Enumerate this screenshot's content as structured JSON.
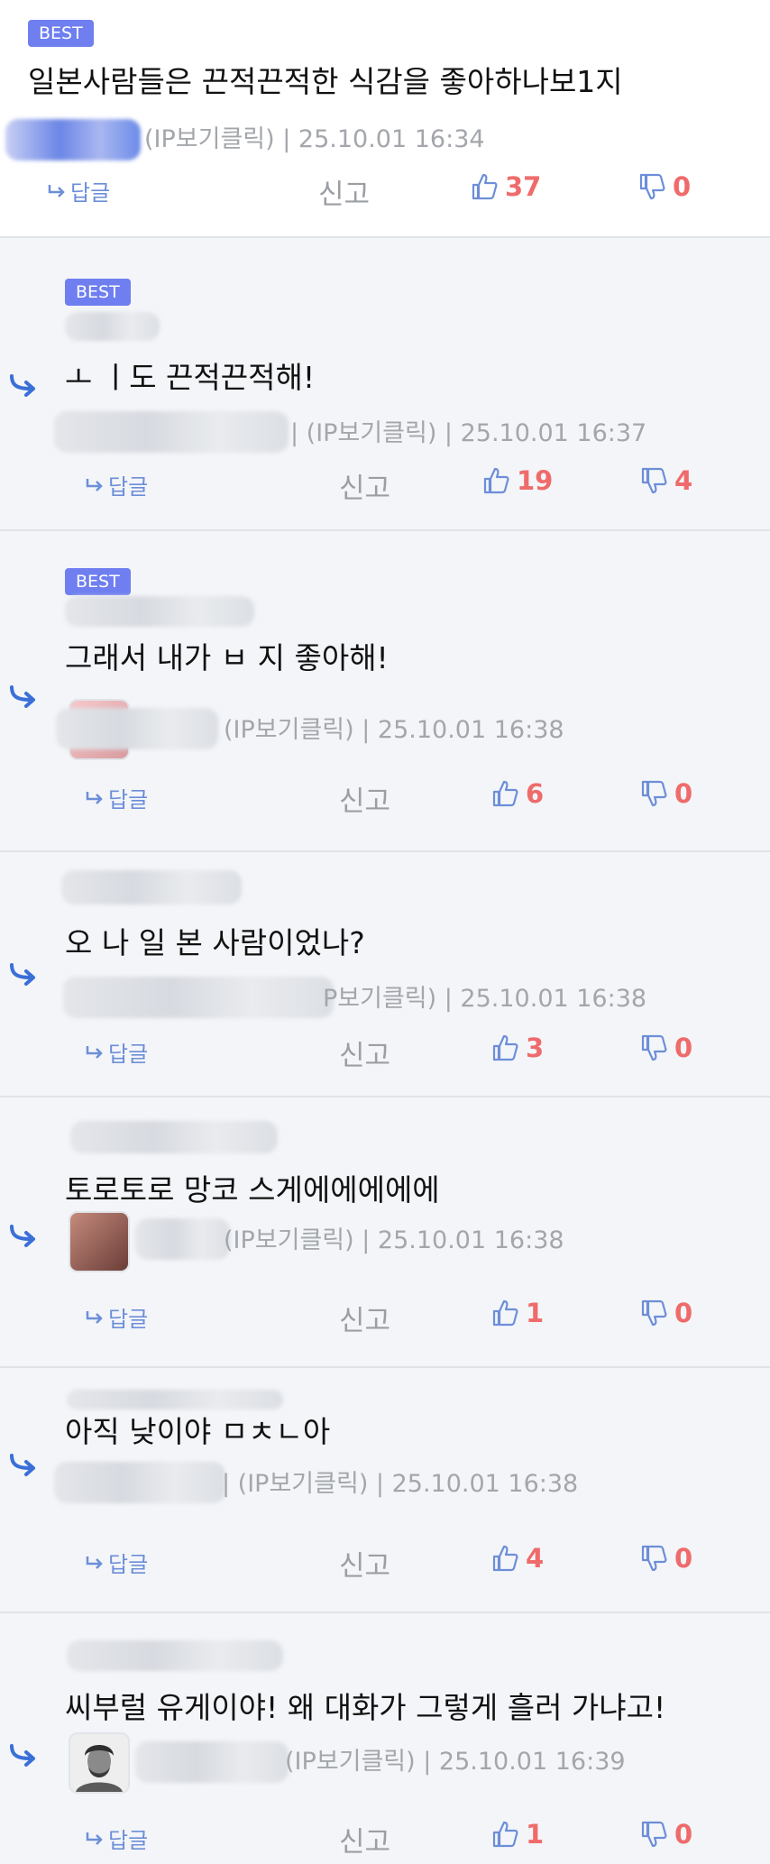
{
  "colors": {
    "accent": "#6f7ff0",
    "link": "#6d8ed8",
    "count": "#ef6b6b",
    "meta": "#a3a6ab",
    "divider": "#dfe3e8",
    "reply_bg": "#f3f5f8"
  },
  "icons": {
    "reply_arrow": "reply-arrow-icon",
    "like": "thumbs-up-icon",
    "dislike": "thumbs-down-icon",
    "reply_small": "reply-small-icon"
  },
  "labels": {
    "best": "BEST",
    "reply": "답글",
    "report": "신고"
  },
  "comments": [
    {
      "text": "일본사람들은 끈적끈적한 식감을 좋아하나보1지",
      "meta": "(IP보기클릭) | 25.10.01 16:34",
      "likes": "37",
      "dislikes": "0",
      "best": true
    },
    {
      "text": "ㅗ  ㅣ도 끈적끈적해!",
      "meta": "| (IP보기클릭) | 25.10.01 16:37",
      "likes": "19",
      "dislikes": "4",
      "best": true
    },
    {
      "text": "그래서 내가 ㅂ  지 좋아해!",
      "meta": "(IP보기클릭) | 25.10.01 16:38",
      "likes": "6",
      "dislikes": "0",
      "best": true
    },
    {
      "text": "오 나 일 본 사람이었나?",
      "meta": "P보기클릭) | 25.10.01 16:38",
      "likes": "3",
      "dislikes": "0",
      "best": false
    },
    {
      "text": "토로토로 망코 스게에에에에에",
      "meta": "(IP보기클릭) | 25.10.01 16:38",
      "likes": "1",
      "dislikes": "0",
      "best": false
    },
    {
      "text": "아직 낮이야 ㅁㅊㄴ아",
      "meta": "| (IP보기클릭) | 25.10.01 16:38",
      "likes": "4",
      "dislikes": "0",
      "best": false
    },
    {
      "text": "씨부럴 유게이야! 왜 대화가 그렇게 흘러 가냐고!",
      "meta": "(IP보기클릭) | 25.10.01 16:39",
      "likes": "1",
      "dislikes": "0",
      "best": false
    }
  ]
}
